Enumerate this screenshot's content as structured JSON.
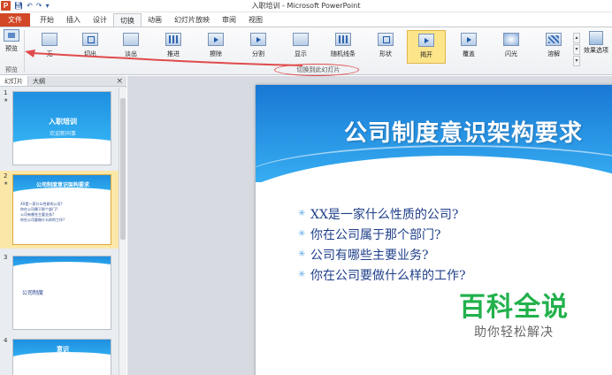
{
  "window": {
    "title": "入职培训 - Microsoft PowerPoint",
    "app_icon": "P",
    "qat": [
      "save-icon",
      "undo-icon",
      "redo-icon",
      "customize-icon"
    ]
  },
  "tabs": [
    "文件",
    "开始",
    "插入",
    "设计",
    "切换",
    "动画",
    "幻灯片放映",
    "审阅",
    "视图"
  ],
  "active_tab": "切换",
  "ribbon": {
    "preview_label": "预览",
    "preview_group": "预览",
    "transitions_group": "切换到此幻灯片",
    "gallery": [
      {
        "label": "无",
        "icon": "none"
      },
      {
        "label": "切出",
        "icon": "box"
      },
      {
        "label": "淡出",
        "icon": "plain"
      },
      {
        "label": "推进",
        "icon": "bars"
      },
      {
        "label": "擦除",
        "icon": "arrow"
      },
      {
        "label": "分割",
        "icon": "arrow"
      },
      {
        "label": "显示",
        "icon": "plain"
      },
      {
        "label": "随机线条",
        "icon": "bars"
      },
      {
        "label": "形状",
        "icon": "box"
      },
      {
        "label": "揭开",
        "icon": "arrow",
        "selected": true
      },
      {
        "label": "覆盖",
        "icon": "arrow"
      },
      {
        "label": "闪光",
        "icon": "flash"
      },
      {
        "label": "溶解",
        "icon": "grid"
      }
    ],
    "effect_options": "效果选项"
  },
  "pane": {
    "tabs": [
      "幻灯片",
      "大纲"
    ],
    "close": "×",
    "slides": [
      {
        "num": "1",
        "title": "入职培训",
        "subtitle": "欢迎新同事"
      },
      {
        "num": "2",
        "title": "公司制度意识架构要求",
        "bullets": [
          "XX是一家什么性质的公司?",
          "你在公司属于那个部门?",
          "公司有哪些主要业务?",
          "你在公司要做什么样的工作?"
        ]
      },
      {
        "num": "3",
        "text": "公司制度"
      },
      {
        "num": "4",
        "title": "意识"
      }
    ]
  },
  "slide": {
    "title": "公司制度意识架构要求",
    "bullets": [
      "XX是一家什么性质的公司?",
      "你在公司属于那个部门?",
      "公司有哪些主要业务?",
      "你在公司要做什么样的工作?"
    ]
  },
  "watermark": {
    "main": "百科全说",
    "sub": "助你轻松解决"
  },
  "colors": {
    "file_tab": "#d24726",
    "annotation_red": "#e04b4b",
    "slide_blue": "#1978d4",
    "watermark_green": "#22b14c"
  }
}
